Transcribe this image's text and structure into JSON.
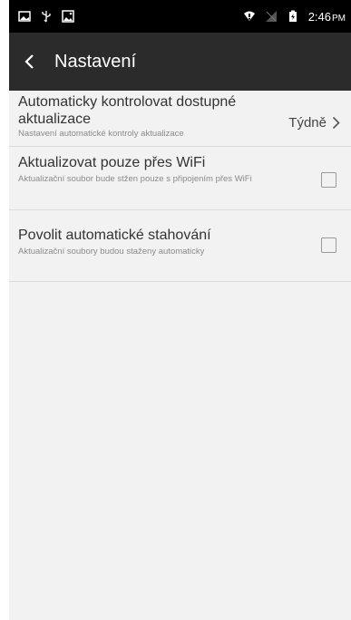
{
  "status_bar": {
    "time": "2:46",
    "ampm": "PM",
    "left_icons": [
      "image-icon",
      "usb-icon",
      "gallery-icon"
    ],
    "right_icons": [
      "wifi-icon",
      "no-signal-icon",
      "battery-icon"
    ]
  },
  "toolbar": {
    "title": "Nastavení",
    "back_icon": "chevron-left-icon"
  },
  "settings": [
    {
      "title": "Automaticky kontrolovat dostupné aktualizace",
      "subtitle": "Nastavení automatické kontroly aktualizace",
      "value": "Týdně",
      "control": "chevron"
    },
    {
      "title": "Aktualizovat pouze přes WiFi",
      "subtitle": "Aktualizační soubor bude stžen pouze s připojením přes WiFi",
      "checked": false,
      "control": "checkbox"
    },
    {
      "title": "Povolit automatické stahování",
      "subtitle": "Aktualizační soubory budou staženy automaticky",
      "checked": false,
      "control": "checkbox"
    }
  ],
  "colors": {
    "status_bar": "#000000",
    "toolbar": "#2b2b2b",
    "background": "#f2f2f2",
    "divider": "#dcdcdc"
  }
}
